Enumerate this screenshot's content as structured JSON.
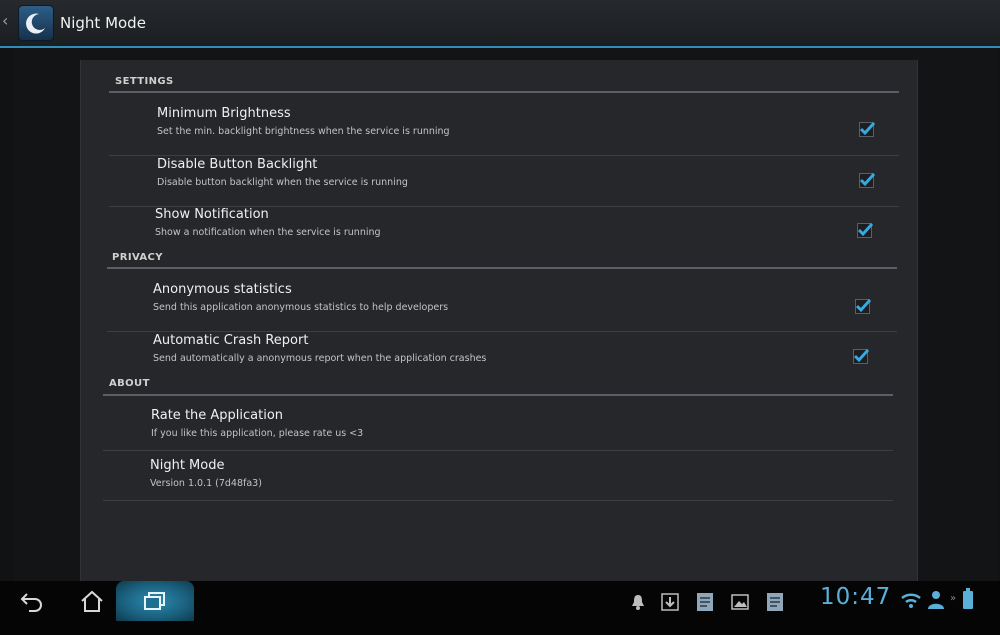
{
  "app": {
    "title": "Night Mode"
  },
  "sections": [
    {
      "header": "SETTINGS",
      "items": [
        {
          "title": "Minimum Brightness",
          "summary": "Set the min. backlight brightness when the service is running",
          "checked": true
        },
        {
          "title": "Disable Button Backlight",
          "summary": "Disable button backlight when the service is running",
          "checked": true
        },
        {
          "title": "Show Notification",
          "summary": "Show a notification when the service is running",
          "checked": true
        }
      ]
    },
    {
      "header": "PRIVACY",
      "items": [
        {
          "title": "Anonymous statistics",
          "summary": "Send this application anonymous statistics to help developers",
          "checked": true
        },
        {
          "title": "Automatic Crash Report",
          "summary": "Send automatically a anonymous report when the application crashes",
          "checked": true
        }
      ]
    },
    {
      "header": "ABOUT",
      "items": [
        {
          "title": "Rate the Application",
          "summary": "If you like this application, please rate us <3"
        },
        {
          "title": "Night Mode",
          "summary": "Version 1.0.1 (7d48fa3)"
        }
      ]
    }
  ],
  "status_bar": {
    "time": "10:47",
    "icons": [
      "notification-bell-icon",
      "download-icon",
      "document-icon",
      "image-icon",
      "document-icon",
      "wifi-icon",
      "user-icon",
      "battery-icon"
    ]
  },
  "colors": {
    "accent": "#2f8fb8",
    "check": "#36a9e0",
    "clock": "#5ab0d8"
  }
}
